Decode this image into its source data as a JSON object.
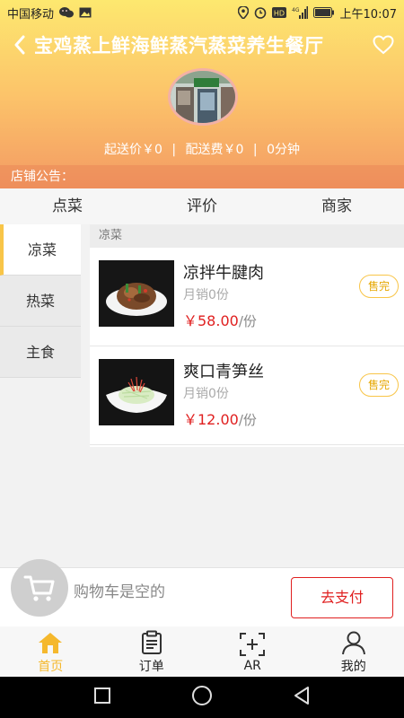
{
  "status_bar": {
    "carrier": "中国移动",
    "time": "上午10:07"
  },
  "header": {
    "shop_name": "宝鸡蒸上鲜海鲜蒸汽蒸菜养生餐厅",
    "min_order": "起送价￥0",
    "delivery_fee": "配送费￥0",
    "delivery_time": "0分钟",
    "separator": "|",
    "notice_label": "店铺公告："
  },
  "tabs": [
    {
      "label": "点菜"
    },
    {
      "label": "评价"
    },
    {
      "label": "商家"
    }
  ],
  "categories": [
    {
      "label": "凉菜"
    },
    {
      "label": "热菜"
    },
    {
      "label": "主食"
    }
  ],
  "menu": {
    "section_title": "凉菜",
    "dishes": [
      {
        "name": "凉拌牛腱肉",
        "sales": "月销0份",
        "price": "￥58.00",
        "unit": "/份",
        "status": "售完"
      },
      {
        "name": "爽口青笋丝",
        "sales": "月销0份",
        "price": "￥12.00",
        "unit": "/份",
        "status": "售完"
      }
    ]
  },
  "cart": {
    "empty_text": "购物车是空的",
    "pay_label": "去支付"
  },
  "bottom_nav": [
    {
      "label": "首页",
      "icon": "home-icon"
    },
    {
      "label": "订单",
      "icon": "clipboard-icon"
    },
    {
      "label": "AR",
      "icon": "scan-add-icon"
    },
    {
      "label": "我的",
      "icon": "person-icon"
    }
  ],
  "colors": {
    "accent": "#f8c548",
    "price": "#e02020",
    "header_top": "#fde86f",
    "header_bottom": "#f39a63"
  }
}
